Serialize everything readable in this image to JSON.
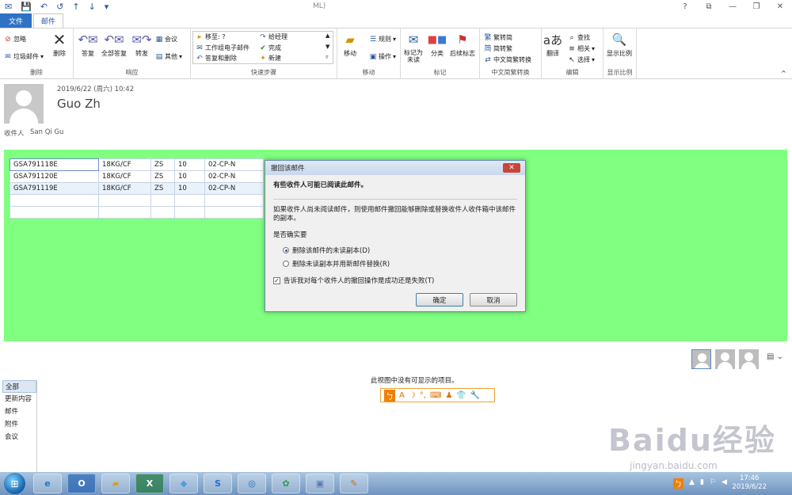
{
  "title": {
    "text": "ML)"
  },
  "window_buttons": {
    "help": "?",
    "restore": "⧉",
    "minimize": "—",
    "maximize": "❐",
    "close": "✕"
  },
  "tabs": {
    "file": "文件",
    "mail": "邮件"
  },
  "ribbon": {
    "delete_group": {
      "label": "删除",
      "ignore": "忽略",
      "junk": "垃圾邮件",
      "delete": "删除"
    },
    "respond_group": {
      "label": "响应",
      "reply": "答复",
      "reply_all": "全部答复",
      "forward": "转发",
      "meeting": "会议",
      "more": "其他"
    },
    "quick_steps": {
      "label": "快速步骤",
      "items": [
        "移至: ?",
        "工作组电子邮件",
        "答复和删除",
        "给经理",
        "完成",
        "新建"
      ]
    },
    "move_group": {
      "label": "移动",
      "move": "移动",
      "rules": "规则",
      "actions": "操作"
    },
    "tags_group": {
      "label": "标记",
      "mark_unread": "标记为未读",
      "categorize": "分类",
      "followup": "后续标志"
    },
    "convert_group": {
      "label": "中文简繁转换",
      "to_simplified": "繁转简",
      "to_traditional": "简转繁",
      "convert": "中文简繁转换"
    },
    "edit_group": {
      "label": "编辑",
      "translate": "翻译",
      "find": "查找",
      "related": "相关",
      "select": "选择"
    },
    "zoom_group": {
      "label": "显示比例",
      "zoom": "显示比例"
    }
  },
  "message": {
    "date": "2019/6/22 (周六) 10:42",
    "sender": "Guo Zh",
    "to_label": "收件人",
    "to": "San Qi Gu"
  },
  "table": {
    "rows": [
      [
        "GSA791118E",
        "18KG/CF",
        "ZS",
        "10",
        "02-CP-N"
      ],
      [
        "GSA791120E",
        "18KG/CF",
        "ZS",
        "10",
        "02-CP-N"
      ],
      [
        "GSA791119E",
        "18KG/CF",
        "ZS",
        "10",
        "02-CP-N"
      ]
    ]
  },
  "dialog": {
    "title": "撤回该邮件",
    "heading": "有些收件人可能已阅读此邮件。",
    "description": "如果收件人尚未阅读邮件，则使用邮件撤回能够删除或替换收件人收件箱中该邮件的副本。",
    "question": "是否确实要",
    "option1": "删除该邮件的未读副本(D)",
    "option2": "删除未读副本并用新邮件替换(R)",
    "checkbox": "告诉我对每个收件人的撤回操作是成功还是失败(T)",
    "ok": "确定",
    "cancel": "取消"
  },
  "people_pane": {
    "filters": [
      "全部",
      "更新内容",
      "邮件",
      "附件",
      "会议"
    ],
    "empty": "此视图中没有可显示的项目。"
  },
  "taskbar": {
    "time": "17:46",
    "date": "2019/6/22"
  },
  "watermark": {
    "brand": "Baidu经验",
    "url": "jingyan.baidu.com"
  }
}
